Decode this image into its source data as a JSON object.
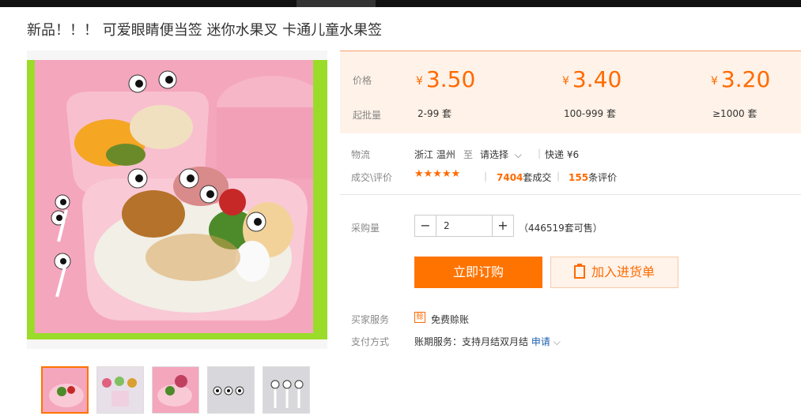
{
  "title": "新品！！！ 可爱眼睛便当签 迷你水果叉 卡通儿童水果签",
  "price_panel": {
    "price_label": "价格",
    "min_order_label": "起批量",
    "tiers": [
      {
        "currency": "¥",
        "price": "3.50",
        "qty": "2-99 套"
      },
      {
        "currency": "¥",
        "price": "3.40",
        "qty": "100-999 套"
      },
      {
        "currency": "¥",
        "price": "3.20",
        "qty": "≥1000 套"
      }
    ]
  },
  "logistics": {
    "label": "物流",
    "origin": "浙江 温州",
    "to": "至",
    "destination": "请选择",
    "express": "快递 ¥6"
  },
  "deals": {
    "label": "成交\\评价",
    "stars": "★★★★★",
    "sold_count": "7404",
    "sold_unit": "套成交",
    "review_count": "155",
    "review_unit": "条评价"
  },
  "purchase": {
    "label": "采购量",
    "minus": "−",
    "plus": "+",
    "quantity": "2",
    "stock": "（446519套可售）"
  },
  "buttons": {
    "buy_now": "立即订购",
    "add_cart": "加入进货单"
  },
  "service": {
    "label": "买家服务",
    "badge": "赊",
    "text": "免费赊账"
  },
  "payment": {
    "label": "支付方式",
    "text": "账期服务：支持月结双月结",
    "link": "申请"
  },
  "colors": {
    "accent": "#ff6a00",
    "frame_green": "#9bdc2a",
    "price_bg": "#fff2e8"
  }
}
